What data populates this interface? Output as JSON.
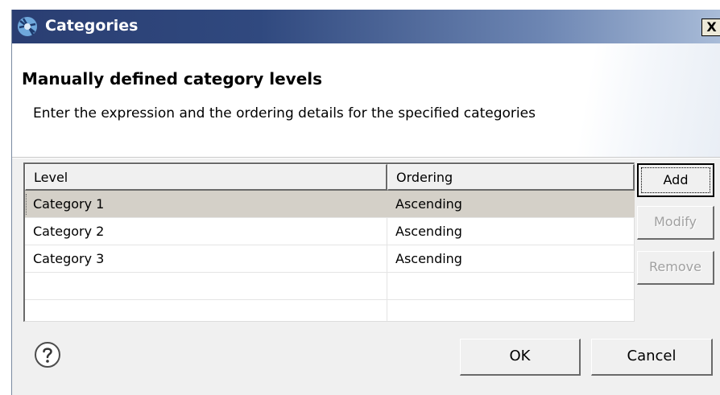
{
  "window": {
    "title": "Categories",
    "close_label": "X"
  },
  "banner": {
    "title": "Manually defined category levels",
    "description": "Enter the expression and the ordering details for the specified categories"
  },
  "table": {
    "columns": [
      "Level",
      "Ordering"
    ],
    "rows": [
      {
        "level": "Category 1",
        "ordering": "Ascending",
        "selected": true
      },
      {
        "level": "Category 2",
        "ordering": "Ascending",
        "selected": false
      },
      {
        "level": "Category 3",
        "ordering": "Ascending",
        "selected": false
      }
    ]
  },
  "side_buttons": {
    "add": "Add",
    "modify": "Modify",
    "remove": "Remove"
  },
  "footer": {
    "ok": "OK",
    "cancel": "Cancel",
    "help_icon": "question-mark-circle"
  },
  "colors": {
    "titlebar_start": "#2a3e72",
    "titlebar_end": "#a9bcd8",
    "selection": "#d4d0c8",
    "dialog_bg": "#f0f0f0"
  }
}
